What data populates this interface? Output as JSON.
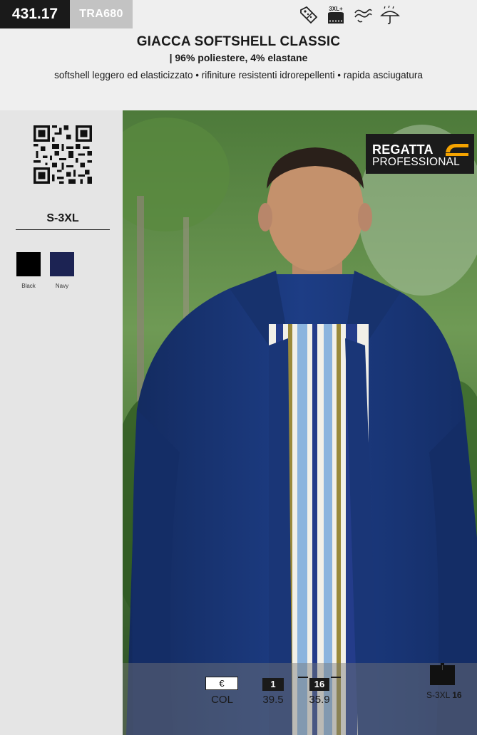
{
  "header": {
    "code": "431.17",
    "sku": "TRA680",
    "feature_icons": [
      "discount-tag-icon",
      "extended-size-3xl-icon",
      "breathable-icon",
      "water-repellent-icon"
    ],
    "icon_labels": {
      "size_badge": "3XL+"
    },
    "title": "GIACCA SOFTSHELL CLASSIC",
    "subtitle": "| 96% poliestere, 4% elastane",
    "features": "softshell leggero ed elasticizzato • rifiniture resistenti idrorepellenti • rapida asciugatura"
  },
  "sidebar": {
    "size_range": "S-3XL",
    "colors": [
      {
        "name": "Black",
        "hex": "#000000"
      },
      {
        "name": "Navy",
        "hex": "#1c2353"
      }
    ]
  },
  "brand": {
    "line1": "REGATTA",
    "line2": "PROFESSIONAL",
    "accent": "#f5a300"
  },
  "pricing": {
    "currency_symbol": "€",
    "col_label": "COL",
    "tiers": [
      {
        "qty": "1",
        "price": "39.5"
      },
      {
        "qty": "16",
        "price": "35.9"
      }
    ],
    "carton": {
      "sizes": "S-3XL",
      "qty": "16"
    }
  }
}
